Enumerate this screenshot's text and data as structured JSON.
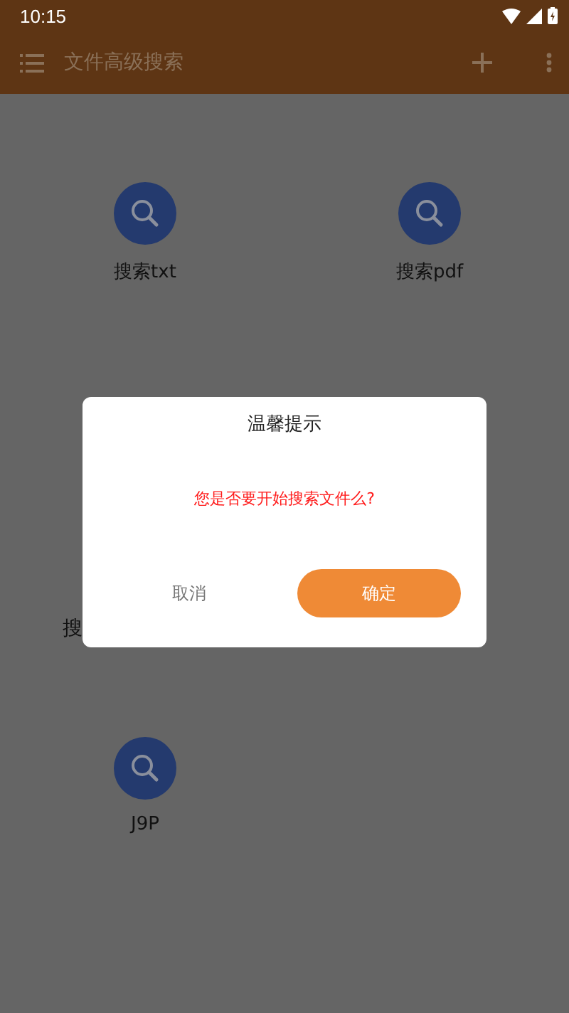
{
  "status_bar": {
    "time": "10:15"
  },
  "toolbar": {
    "title": "文件高级搜索"
  },
  "grid_rows": [
    [
      {
        "kind": "search",
        "label": "搜索txt"
      },
      {
        "kind": "search",
        "label": "搜索pdf"
      }
    ],
    [
      {
        "kind": "covered",
        "label": "搜"
      }
    ],
    [
      {
        "kind": "search",
        "label": "J9P"
      }
    ]
  ],
  "dialog": {
    "title": "温馨提示",
    "message": "您是否要开始搜索文件么?",
    "cancel": "取消",
    "confirm": "确定"
  }
}
